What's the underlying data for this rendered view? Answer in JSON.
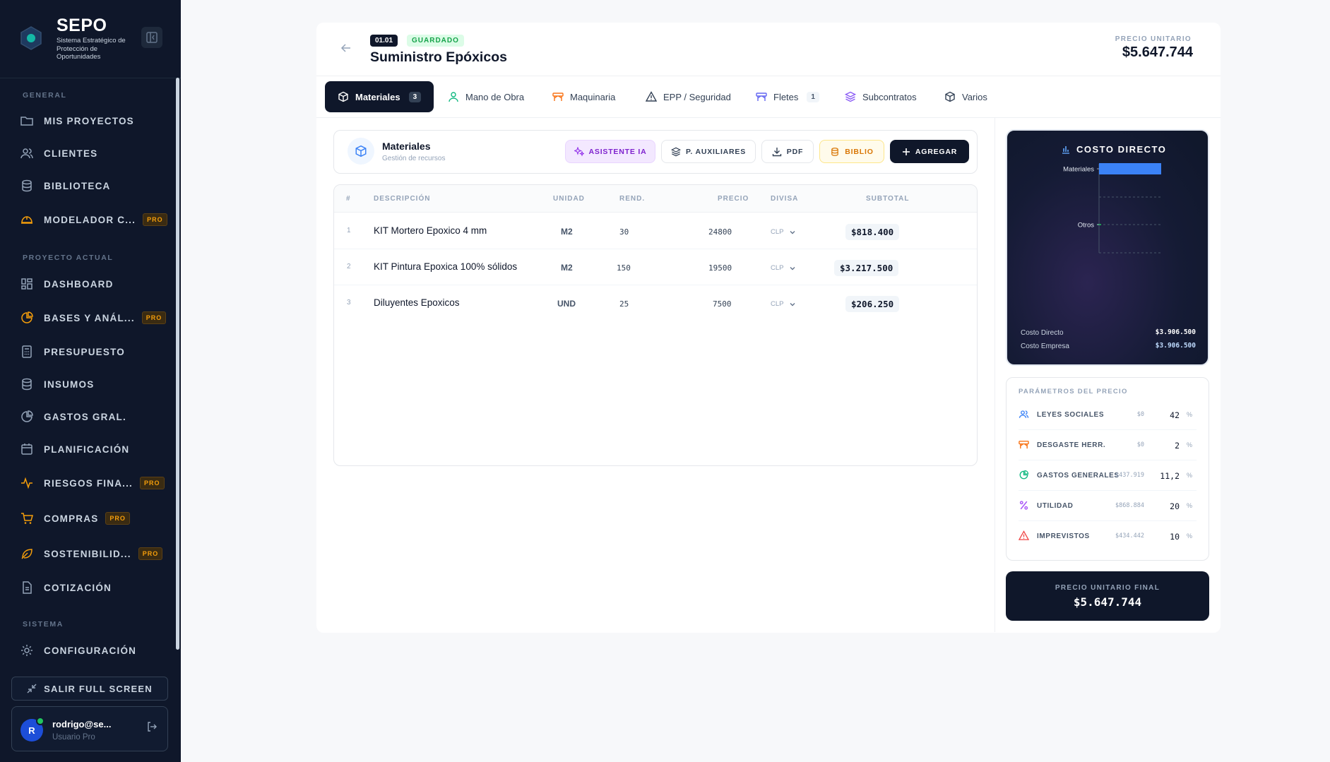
{
  "sidebar": {
    "brand_name": "SEPO",
    "brand_subtitle": "Sistema Estratégico de Protección de Oportunidades",
    "section_general": "GENERAL",
    "section_project": "PROYECTO ACTUAL",
    "section_system": "SISTEMA",
    "items": [
      {
        "label": "MIS PROYECTOS",
        "icon": "folder-icon"
      },
      {
        "label": "CLIENTES",
        "icon": "users-icon"
      },
      {
        "label": "BIBLIOTECA",
        "icon": "database-icon"
      },
      {
        "label": "MODELADOR C...",
        "icon": "hardhat-icon",
        "badge": "PRO"
      },
      {
        "label": "DASHBOARD",
        "icon": "grid-icon"
      },
      {
        "label": "BASES Y ANÁL...",
        "icon": "analysis-icon",
        "badge": "PRO"
      },
      {
        "label": "PRESUPUESTO",
        "icon": "calculator-icon"
      },
      {
        "label": "INSUMOS",
        "icon": "database-icon"
      },
      {
        "label": "GASTOS GRAL.",
        "icon": "pie-icon"
      },
      {
        "label": "PLANIFICACIÓN",
        "icon": "calendar-icon"
      },
      {
        "label": "RIESGOS FINA...",
        "icon": "activity-icon",
        "badge": "PRO"
      },
      {
        "label": "COMPRAS",
        "icon": "cart-icon",
        "badge": "PRO"
      },
      {
        "label": "SOSTENIBILID...",
        "icon": "leaf-icon",
        "badge": "PRO"
      },
      {
        "label": "COTIZACIÓN",
        "icon": "document-icon"
      },
      {
        "label": "CONFIGURACIÓN",
        "icon": "gear-icon"
      }
    ],
    "exit_fullscreen": "SALIR FULL SCREEN",
    "user": {
      "initial": "R",
      "name": "rodrigo@se...",
      "role": "Usuario Pro"
    }
  },
  "header": {
    "code": "01.01",
    "status": "GUARDADO",
    "title": "Suministro Epóxicos",
    "unit_price_label": "PRECIO UNITARIO",
    "unit_price_value": "$5.647.744"
  },
  "tabs": [
    {
      "label": "Materiales",
      "count": "3",
      "icon": "box-icon"
    },
    {
      "label": "Mano de Obra",
      "icon": "user-icon"
    },
    {
      "label": "Maquinaria",
      "icon": "machinery-icon"
    },
    {
      "label": "EPP / Seguridad",
      "icon": "warning-icon"
    },
    {
      "label": "Fletes",
      "count": "1",
      "icon": "truck-icon"
    },
    {
      "label": "Subcontratos",
      "icon": "layers-icon"
    },
    {
      "label": "Varios",
      "icon": "package-icon"
    }
  ],
  "materials": {
    "title": "Materiales",
    "subtitle": "Gestión de recursos",
    "buttons": {
      "ai": "ASISTENTE IA",
      "aux": "P. AUXILIARES",
      "pdf": "PDF",
      "biblio": "BIBLIO",
      "add": "AGREGAR"
    },
    "columns": [
      "#",
      "DESCRIPCIÓN",
      "UNIDAD",
      "REND.",
      "PRECIO",
      "DIVISA",
      "SUBTOTAL"
    ],
    "rows": [
      {
        "num": "1",
        "desc": "KIT Mortero Epoxico 4 mm",
        "unit": "M2",
        "rend": "30",
        "price": "24800",
        "currency": "CLP",
        "subtotal": "$818.400"
      },
      {
        "num": "2",
        "desc": "KIT Pintura Epoxica 100% sólidos",
        "unit": "M2",
        "rend": "150",
        "price": "19500",
        "currency": "CLP",
        "subtotal": "$3.217.500"
      },
      {
        "num": "3",
        "desc": "Diluyentes Epoxicos",
        "unit": "UND",
        "rend": "25",
        "price": "7500",
        "currency": "CLP",
        "subtotal": "$206.250"
      }
    ]
  },
  "cost_panel": {
    "title": "COSTO DIRECTO",
    "direct_cost_label": "Costo Directo",
    "direct_cost_value": "$3.906.500",
    "company_cost_label": "Costo Empresa",
    "company_cost_value": "$3.906.500"
  },
  "chart_data": {
    "type": "bar",
    "orientation": "horizontal",
    "categories": [
      "Materiales",
      "Otros"
    ],
    "values": [
      4242150,
      0
    ],
    "xlim": [
      0,
      4242150
    ],
    "grid": true,
    "colors": [
      "#3b82f6",
      "#22c55e"
    ]
  },
  "params": {
    "title": "PARÁMETROS DEL PRECIO",
    "rows": [
      {
        "label": "LEYES SOCIALES",
        "amount": "$0",
        "value": "42",
        "pct": "%",
        "icon": "users-icon",
        "color": "#3b82f6"
      },
      {
        "label": "DESGASTE HERR.",
        "amount": "$0",
        "value": "2",
        "pct": "%",
        "icon": "machinery-icon",
        "color": "#f97316"
      },
      {
        "label": "GASTOS GENERALES",
        "amount": "$437.919",
        "value": "11,2",
        "pct": "%",
        "icon": "pie-icon",
        "color": "#10b981"
      },
      {
        "label": "UTILIDAD",
        "amount": "$868.884",
        "value": "20",
        "pct": "%",
        "icon": "percent-icon",
        "color": "#a855f7"
      },
      {
        "label": "IMPREVISTOS",
        "amount": "$434.442",
        "value": "10",
        "pct": "%",
        "icon": "warning-icon",
        "color": "#ef4444"
      }
    ]
  },
  "final_price": {
    "label": "PRECIO UNITARIO FINAL",
    "value": "$5.647.744"
  }
}
